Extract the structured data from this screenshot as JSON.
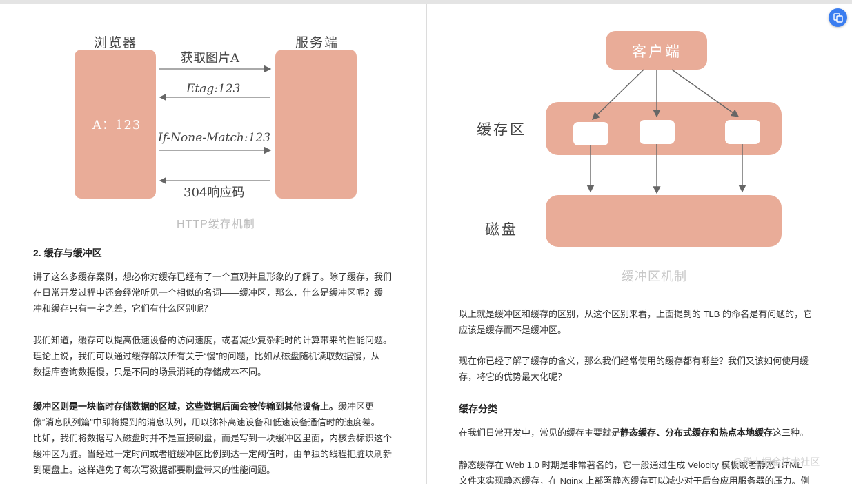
{
  "left": {
    "diagram": {
      "browser_label": "浏览器",
      "server_label": "服务端",
      "browser_value": "A：123",
      "arrows": [
        {
          "label": "获取图片A",
          "direction": "right"
        },
        {
          "label": "Etag:123",
          "direction": "left"
        },
        {
          "label": "If-None-Match:123",
          "direction": "right"
        },
        {
          "label": "304响应码",
          "direction": "left"
        }
      ],
      "caption": "HTTP缓存机制"
    },
    "heading": "2. 缓存与缓冲区",
    "para1": {
      "lines": [
        "讲了这么多缓存案例，想必你对缓存已经有了一个直观并且形象的了解了。除了缓存，我们",
        "在日常开发过程中还会经常听见一个相似的名词——缓冲区，那么，什么是缓冲区呢？缓",
        "冲和缓存只有一字之差，它们有什么区别呢？"
      ]
    },
    "para2": {
      "lines": [
        "我们知道，缓存可以提高低速设备的访问速度，或者减少复杂耗时的计算带来的性能问题。",
        "理论上说，我们可以通过缓存解决所有关于“慢”的问题，比如从磁盘随机读取数据慢，从",
        "数据库查询数据慢，只是不同的场景消耗的存储成本不同。"
      ]
    },
    "para3": {
      "bold_start": "缓冲区则是一块临时存储数据的区域，这些数据后面会被传输到其他设备上。",
      "line1_rest": "缓冲区更",
      "lines": [
        "像“消息队列篇”中即将提到的消息队列，用以弥补高速设备和低速设备通信时的速度差。",
        "比如，我们将数据写入磁盘时并不是直接刷盘，而是写到一块缓冲区里面，内核会标识这个",
        "缓冲区为脏。当经过一定时间或者脏缓冲区比例到达一定阈值时，由单独的线程把脏块刷新",
        "到硬盘上。这样避免了每次写数据都要刷盘带来的性能问题。"
      ]
    }
  },
  "right": {
    "diagram": {
      "client_label": "客户端",
      "cache_label": "缓存区",
      "disk_label": "磁盘",
      "caption": "缓冲区机制"
    },
    "para1": {
      "lines": [
        "以上就是缓冲区和缓存的区别，从这个区别来看，上面提到的 TLB 的命名是有问题的，它",
        "应该是缓存而不是缓冲区。"
      ]
    },
    "para2": {
      "lines": [
        "现在你已经了解了缓存的含义，那么我们经常使用的缓存都有哪些？我们又该如何使用缓",
        "存，将它的优势最大化呢？"
      ]
    },
    "heading": "缓存分类",
    "para3": {
      "prefix": "在我们日常开发中，常见的缓存主要就是",
      "bold": "静态缓存、分布式缓存和热点本地缓存",
      "suffix": "这三种。"
    },
    "para4": {
      "lines": [
        "静态缓存在 Web 1.0 时期是非常著名的，它一般通过生成 Velocity 模板或者静态 HTML",
        "文件来实现静态缓存，在 Nginx 上部署静态缓存可以减少对于后台应用服务器的压力。例"
      ]
    }
  },
  "watermark": "@稀土掘金技术社区",
  "colors": {
    "box": "#e9ac98",
    "arrow": "#666666",
    "accent": "#3a7df0"
  },
  "icons": {
    "float_button": "copy-page-icon"
  }
}
